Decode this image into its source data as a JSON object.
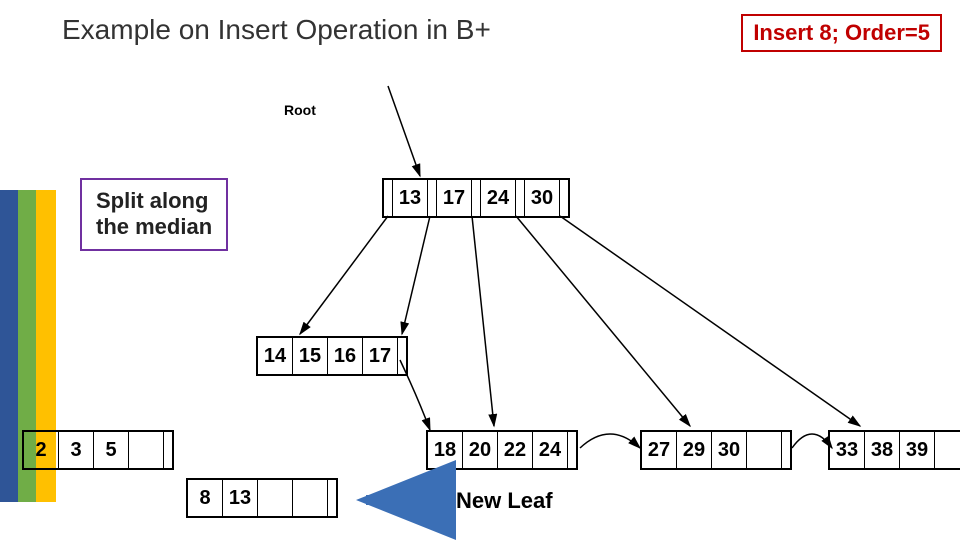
{
  "title": "Example on Insert Operation in B+",
  "badge": "Insert 8; Order=5",
  "root_label": "Root",
  "callout_line1": "Split along",
  "callout_line2": "the median",
  "new_leaf_label": "New Leaf",
  "nodes": {
    "root": [
      "13",
      "17",
      "24",
      "30"
    ],
    "leaf_mid_upper": [
      "14",
      "15",
      "16",
      "17"
    ],
    "leaf_far_left": [
      "2",
      "3",
      "5",
      ""
    ],
    "leaf_mid": [
      "18",
      "20",
      "22",
      "24"
    ],
    "leaf_right": [
      "27",
      "29",
      "30",
      ""
    ],
    "leaf_far_right": [
      "33",
      "38",
      "39",
      ""
    ],
    "new_leaf": [
      "8",
      "13",
      "",
      ""
    ]
  }
}
